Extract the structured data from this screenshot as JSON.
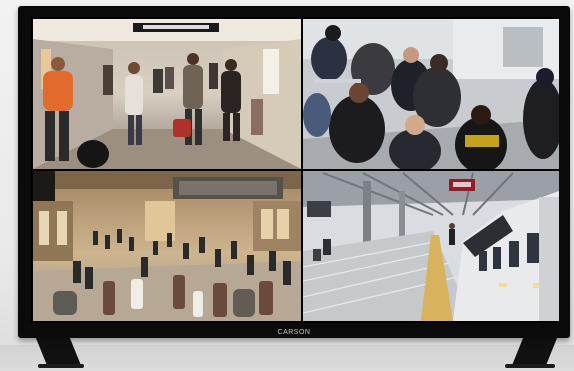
{
  "monitor": {
    "brand": "CARSON"
  },
  "feeds": [
    {
      "scene": "corridor-shoppers"
    },
    {
      "scene": "seated-crowd"
    },
    {
      "scene": "grand-concourse"
    },
    {
      "scene": "train-platform"
    }
  ],
  "colors": {
    "bezel": "#0a0a0a",
    "background": "#efefef"
  }
}
